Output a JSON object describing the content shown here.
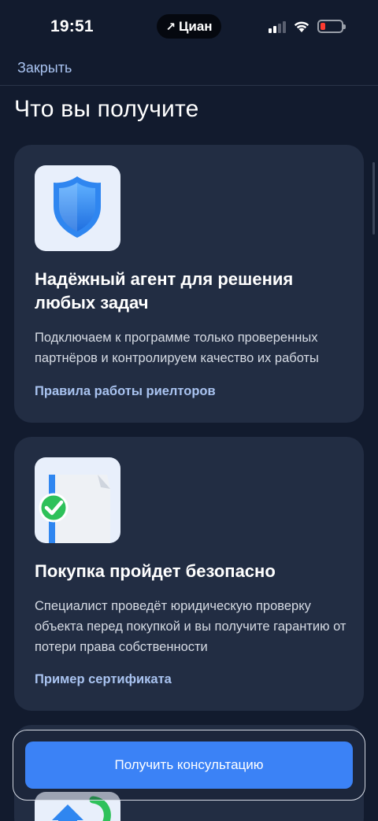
{
  "status_bar": {
    "time": "19:51",
    "carrier_arrow": "↗",
    "carrier": "Циан"
  },
  "header": {
    "close_label": "Закрыть",
    "page_title": "Что вы получите"
  },
  "cards": [
    {
      "icon": "shield-icon",
      "title": "Надёжный агент для решения любых задач",
      "text": "Подключаем к программе только проверенных партнёров и контролируем качество их работы",
      "link": "Правила работы риелторов"
    },
    {
      "icon": "document-check-icon",
      "title": "Покупка пройдет безопасно",
      "text": "Специалист проведёт юридическую проверку объекта перед покупкой и вы получите гарантию от потери права собственности",
      "link": "Пример сертификата"
    },
    {
      "icon": "house-arrow-icon"
    }
  ],
  "cta": {
    "label": "Получить консультацию"
  },
  "colors": {
    "background": "#121b2e",
    "card": "#222d43",
    "link": "#a9c3f0",
    "button": "#3b82f6",
    "battery_low": "#ff3b30"
  }
}
